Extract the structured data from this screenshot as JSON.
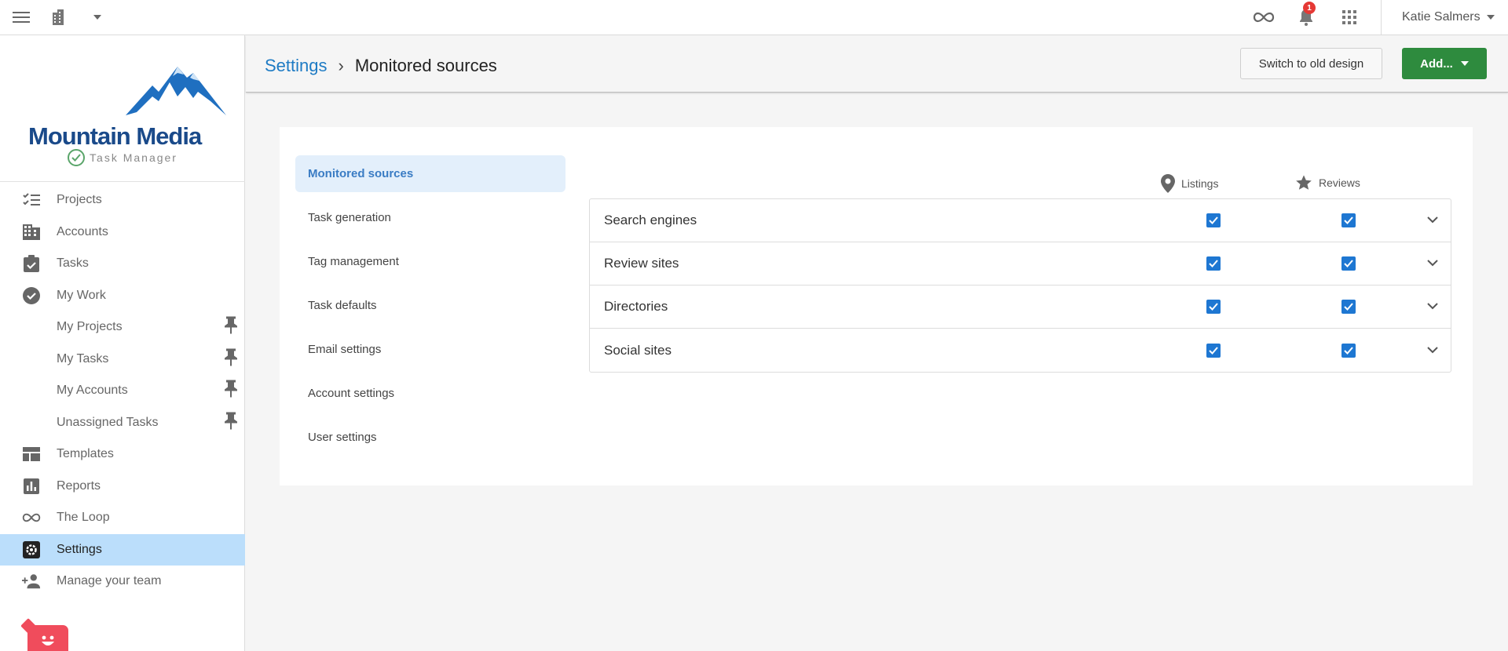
{
  "topbar": {
    "notification_count": "1",
    "user_name": "Katie Salmers"
  },
  "sidebar": {
    "logo_text": "Mountain Media",
    "app_name": "Task Manager",
    "items": [
      {
        "label": "Projects",
        "icon": "checklist-icon"
      },
      {
        "label": "Accounts",
        "icon": "building-icon"
      },
      {
        "label": "Tasks",
        "icon": "clipboard-check-icon"
      },
      {
        "label": "My Work",
        "icon": "check-circle-icon"
      },
      {
        "label": "My Projects",
        "sub": true
      },
      {
        "label": "My Tasks",
        "sub": true
      },
      {
        "label": "My Accounts",
        "sub": true
      },
      {
        "label": "Unassigned Tasks",
        "sub": true
      },
      {
        "label": "Templates",
        "icon": "template-icon"
      },
      {
        "label": "Reports",
        "icon": "bar-chart-icon"
      },
      {
        "label": "The Loop",
        "icon": "infinity-icon"
      },
      {
        "label": "Settings",
        "icon": "gear-icon",
        "active": true
      },
      {
        "label": "Manage your team",
        "icon": "add-person-icon"
      }
    ]
  },
  "header": {
    "breadcrumb_root": "Settings",
    "breadcrumb_sep": "›",
    "breadcrumb_current": "Monitored sources",
    "switch_label": "Switch to old design",
    "add_label": "Add..."
  },
  "settings_tabs": [
    {
      "label": "Monitored sources",
      "active": true
    },
    {
      "label": "Task generation"
    },
    {
      "label": "Tag management"
    },
    {
      "label": "Task defaults"
    },
    {
      "label": "Email settings"
    },
    {
      "label": "Account settings"
    },
    {
      "label": "User settings"
    }
  ],
  "sources": {
    "col_listings": "Listings",
    "col_reviews": "Reviews",
    "rows": [
      {
        "label": "Search engines",
        "listings": true,
        "reviews": true
      },
      {
        "label": "Review sites",
        "listings": true,
        "reviews": true
      },
      {
        "label": "Directories",
        "listings": true,
        "reviews": true
      },
      {
        "label": "Social sites",
        "listings": true,
        "reviews": true
      }
    ]
  },
  "colors": {
    "accent": "#1e7bc4",
    "active_nav": "#bbdefb",
    "add_button": "#2e8b3e",
    "checkbox": "#1e77d2"
  }
}
